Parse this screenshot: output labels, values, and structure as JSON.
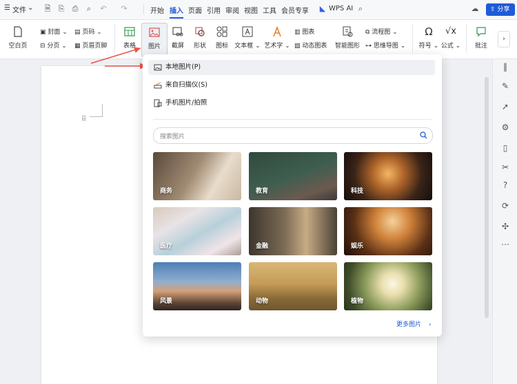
{
  "topbar": {
    "menu_label": "文件",
    "tabs": [
      "开始",
      "插入",
      "页面",
      "引用",
      "审阅",
      "视图",
      "工具",
      "会员专享"
    ],
    "wps_ai": "WPS AI",
    "share_label": "分享"
  },
  "ribbon": {
    "cover": "封面",
    "page_number": "页码",
    "blank_page": "空白页",
    "section": "分页",
    "header_footer": "页眉页脚",
    "table": "表格",
    "picture": "图片",
    "screenshot": "截屏",
    "shape": "形状",
    "icon": "图标",
    "textbox": "文本框",
    "wordart": "艺术字",
    "chart": "图表",
    "dynamic_chart": "动态图表",
    "smart_graphic": "智能图形",
    "flowchart": "流程图",
    "mindmap": "思维导图",
    "symbol": "符号",
    "formula": "公式",
    "comment": "批注"
  },
  "dropdown": {
    "items": [
      {
        "label": "本地图片(P)",
        "icon": "image-icon"
      },
      {
        "label": "来自扫描仪(S)",
        "icon": "scanner-icon"
      },
      {
        "label": "手机图片/拍照",
        "icon": "phone-image-icon"
      }
    ],
    "search_placeholder": "搜索图片",
    "categories": [
      "商务",
      "教育",
      "科技",
      "医疗",
      "金融",
      "娱乐",
      "风景",
      "动物",
      "植物"
    ],
    "more_label": "更多图片"
  },
  "colors": {
    "accent": "#1e5bd8",
    "arrow": "#e8544a"
  }
}
